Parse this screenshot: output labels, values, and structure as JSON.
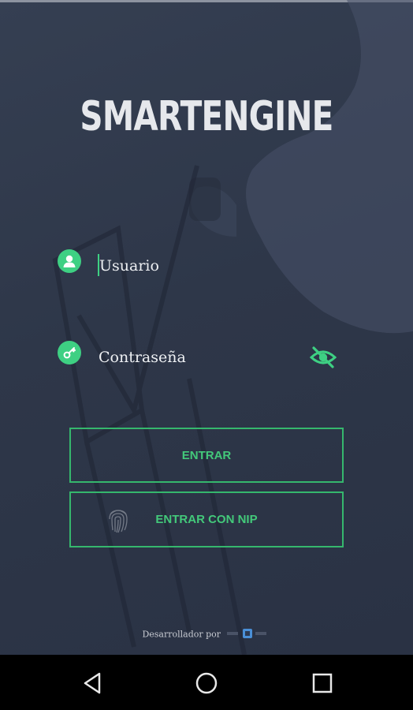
{
  "app": {
    "title": "SMARTENGINE"
  },
  "login": {
    "username_placeholder": "Usuario",
    "password_placeholder": "Contraseña",
    "enter_label": "ENTRAR",
    "enter_nip_label": "ENTRAR CON NIP"
  },
  "footer": {
    "developer_text": "Desarrollador por"
  },
  "icons": {
    "user": "user-icon",
    "key": "key-icon",
    "visibility": "eye-off-icon",
    "fingerprint": "fingerprint-icon",
    "back": "back-icon",
    "home": "home-icon",
    "recents": "recents-icon"
  },
  "colors": {
    "accent": "#3ed083",
    "button_border": "#35b76d",
    "background": "#2e3749",
    "navbar": "#000000"
  }
}
